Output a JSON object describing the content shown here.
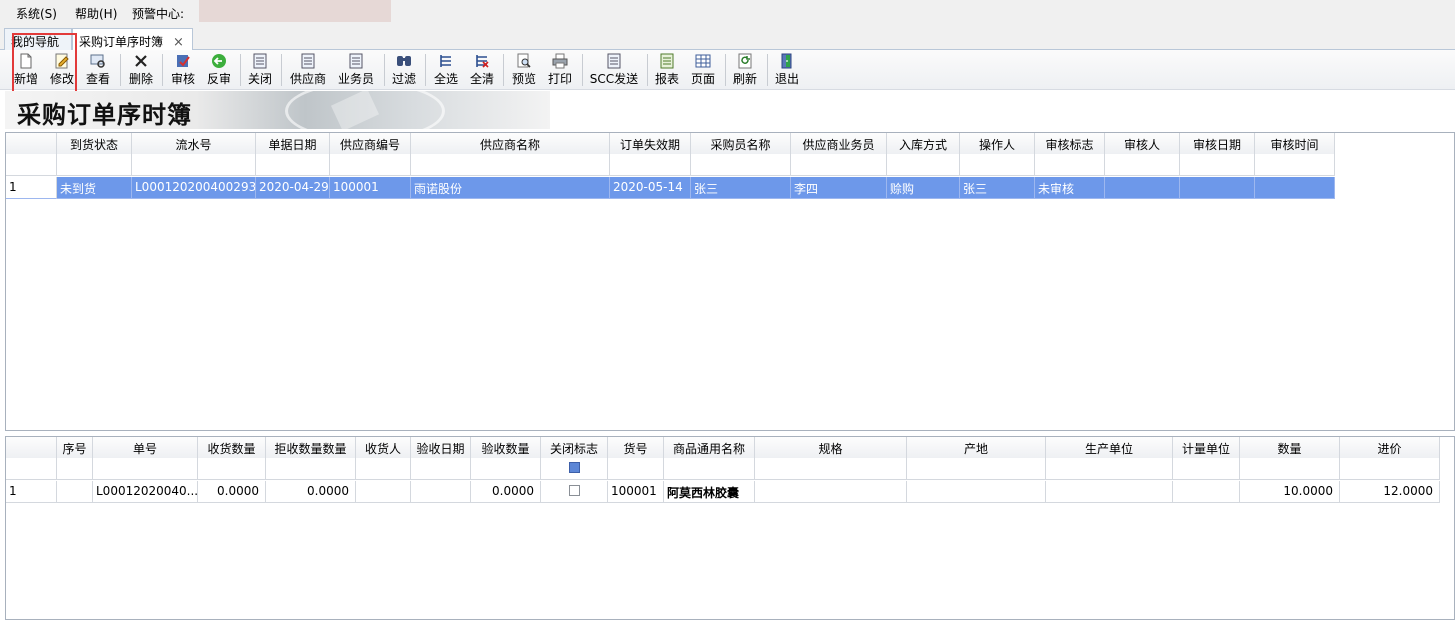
{
  "menu": {
    "items": [
      "系统(S)",
      "帮助(H)",
      "预警中心:"
    ]
  },
  "tabs": [
    {
      "label": "我的导航"
    },
    {
      "label": "采购订单序时簿",
      "close": "×"
    }
  ],
  "toolbar": {
    "buttons": [
      {
        "label": "新增",
        "icon": "new-doc-icon"
      },
      {
        "label": "修改",
        "icon": "edit-icon"
      },
      {
        "label": "查看",
        "icon": "view-icon"
      },
      {
        "label": "删除",
        "icon": "delete-icon"
      },
      {
        "label": "审核",
        "icon": "audit-icon"
      },
      {
        "label": "反审",
        "icon": "unaudit-icon"
      },
      {
        "label": "关闭",
        "icon": "close-doc-icon"
      },
      {
        "label": "供应商",
        "icon": "supplier-icon"
      },
      {
        "label": "业务员",
        "icon": "salesman-icon"
      },
      {
        "label": "过滤",
        "icon": "filter-icon"
      },
      {
        "label": "全选",
        "icon": "select-all-icon"
      },
      {
        "label": "全清",
        "icon": "clear-all-icon"
      },
      {
        "label": "预览",
        "icon": "preview-icon"
      },
      {
        "label": "打印",
        "icon": "print-icon"
      },
      {
        "label": "SCC发送",
        "icon": "send-icon"
      },
      {
        "label": "报表",
        "icon": "report-icon"
      },
      {
        "label": "页面",
        "icon": "page-icon"
      },
      {
        "label": "刷新",
        "icon": "refresh-icon"
      },
      {
        "label": "退出",
        "icon": "exit-icon"
      }
    ]
  },
  "banner": {
    "title": "采购订单序时簿"
  },
  "master_grid": {
    "columns": [
      "",
      "到货状态",
      "流水号",
      "单据日期",
      "供应商编号",
      "供应商名称",
      "订单失效期",
      "采购员名称",
      "供应商业务员",
      "入库方式",
      "操作人",
      "审核标志",
      "审核人",
      "审核日期",
      "审核时间"
    ],
    "rows": [
      [
        "1",
        "未到货",
        "L000120200400293",
        "2020-04-29",
        "100001",
        "雨诺股份",
        "2020-05-14",
        "张三",
        "李四",
        "赊购",
        "张三",
        "未审核",
        "",
        "",
        ""
      ]
    ]
  },
  "detail_grid": {
    "columns": [
      "",
      "序号",
      "单号",
      "收货数量",
      "拒收数量数量",
      "收货人",
      "验收日期",
      "验收数量",
      "关闭标志",
      "货号",
      "商品通用名称",
      "规格",
      "产地",
      "生产单位",
      "计量单位",
      "数量",
      "进价"
    ],
    "rows": [
      [
        "1",
        "",
        "L00012020040...",
        "0.0000",
        "0.0000",
        "",
        "",
        "0.0000",
        "",
        "100001",
        "阿莫西林胶囊",
        "",
        "",
        "",
        "",
        "10.0000",
        "12.0000"
      ]
    ]
  },
  "colors": {
    "selected_row": "#6d98ea",
    "highlight_box": "#e23a3a"
  }
}
